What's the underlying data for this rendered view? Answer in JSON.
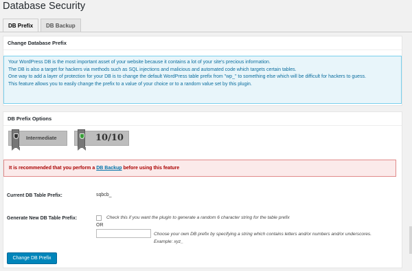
{
  "page": {
    "title": "Database Security"
  },
  "tabs": [
    {
      "label": "DB Prefix",
      "active": true
    },
    {
      "label": "DB Backup",
      "active": false
    }
  ],
  "change_box": {
    "title": "Change Database Prefix"
  },
  "info": {
    "lines": [
      "Your WordPress DB is the most important asset of your website because it contains a lot of your site's precious information.",
      "The DB is also a target for hackers via methods such as SQL injections and malicious and automated code which targets certain tables.",
      "One way to add a layer of protection for your DB is to change the default WordPress table prefix from \"wp_\" to something else which will be difficult for hackers to guess.",
      "This feature allows you to easily change the prefix to a value of your choice or to a random value set by this plugin."
    ]
  },
  "options_box": {
    "title": "DB Prefix Options"
  },
  "badges": {
    "level": {
      "label": "Intermediate",
      "icon": "shield-icon"
    },
    "score": {
      "label": "10/10",
      "icon": "shield-check-icon"
    }
  },
  "alert": {
    "text_before": "It is recommended that you perform a ",
    "link": "DB Backup",
    "text_after": " before using this feature"
  },
  "current_prefix": {
    "label": "Current DB Table Prefix:",
    "value": "sqbcb_"
  },
  "generate": {
    "label": "Generate New DB Table Prefix:",
    "checkbox_help": "Check this if you want the plugin to generate a random 6 character string for the table prefix",
    "or": "OR",
    "input_value": "",
    "input_help": "Choose your own DB prefix by specifying a string which contains letters and/or numbers and/or underscores. Example: xyz_"
  },
  "submit": {
    "label": "Change DB Prefix"
  },
  "colors": {
    "accent": "#0085ba",
    "info_bg": "#e8f5fa",
    "info_text": "#0a6d9e",
    "alert_bg": "#fbeaea",
    "alert_text": "#aa0000"
  }
}
